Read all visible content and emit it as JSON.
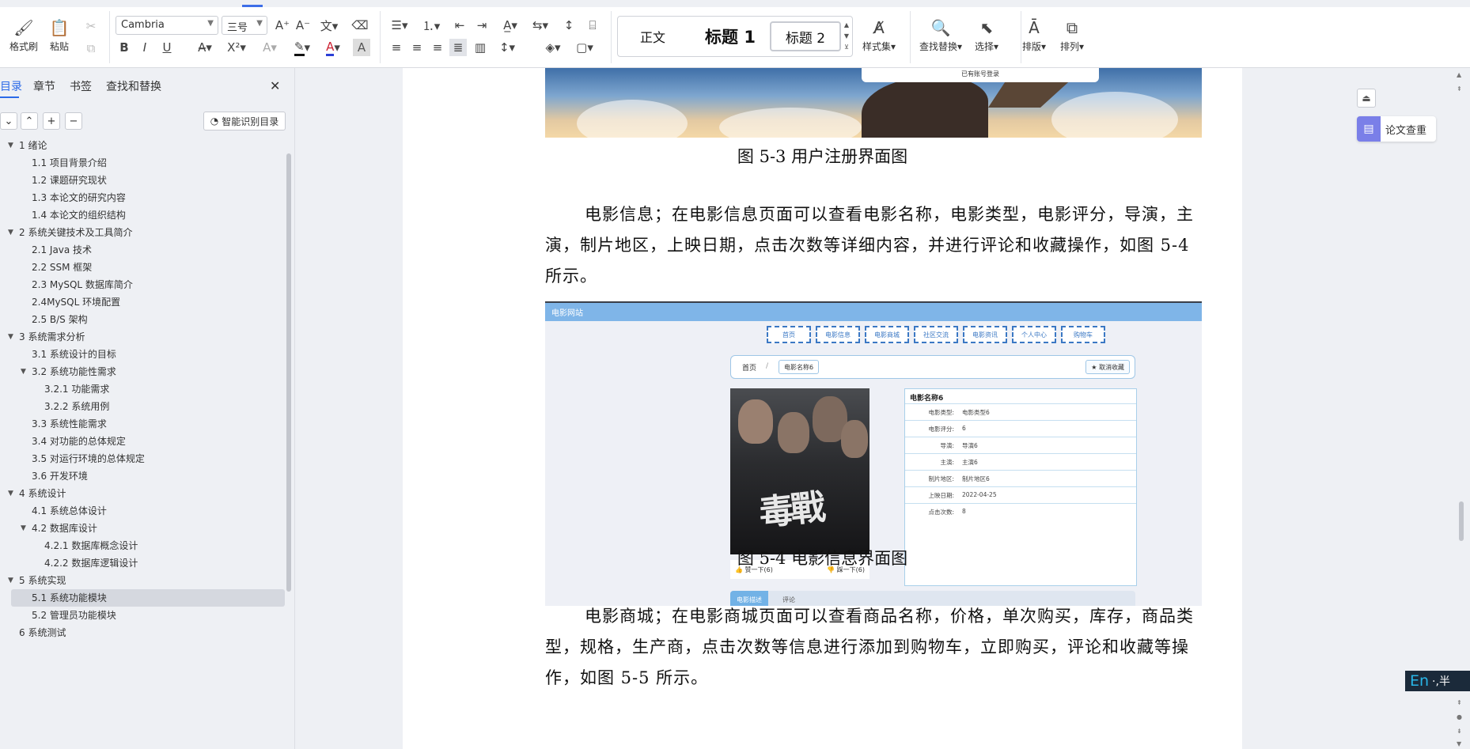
{
  "ribbon": {
    "format_painter": "格式刷",
    "paste": "粘贴",
    "font_name": "Cambria",
    "font_size": "三号",
    "style_gallery": [
      "正文",
      "标题 1",
      "标题 2"
    ],
    "style_set": "样式集",
    "find_replace": "查找替换",
    "select": "选择",
    "layout": "排版",
    "arrange": "排列",
    "bold": "B",
    "italic": "I",
    "underline": "U"
  },
  "nav": {
    "tabs": [
      "目录",
      "章节",
      "书签",
      "查找和替换"
    ],
    "smart_button": "智能识别目录",
    "toc": [
      {
        "label": "1 绪论",
        "level": 0,
        "expanded": true
      },
      {
        "label": "1.1 项目背景介绍",
        "level": 1
      },
      {
        "label": "1.2 课题研究现状",
        "level": 1
      },
      {
        "label": "1.3 本论文的研究内容",
        "level": 1
      },
      {
        "label": "1.4 本论文的组织结构",
        "level": 1
      },
      {
        "label": "2 系统关键技术及工具简介",
        "level": 0,
        "expanded": true
      },
      {
        "label": "2.1 Java 技术",
        "level": 1
      },
      {
        "label": "2.2 SSM 框架",
        "level": 1
      },
      {
        "label": "2.3 MySQL 数据库简介",
        "level": 1
      },
      {
        "label": "2.4MySQL 环境配置",
        "level": 1
      },
      {
        "label": "2.5 B/S 架构",
        "level": 1
      },
      {
        "label": "3 系统需求分析",
        "level": 0,
        "expanded": true
      },
      {
        "label": "3.1 系统设计的目标",
        "level": 1
      },
      {
        "label": "3.2 系统功能性需求",
        "level": 1,
        "expanded": true
      },
      {
        "label": "3.2.1  功能需求",
        "level": 2
      },
      {
        "label": "3.2.2  系统用例",
        "level": 2
      },
      {
        "label": "3.3 系统性能需求",
        "level": 1
      },
      {
        "label": "3.4 对功能的总体规定",
        "level": 1
      },
      {
        "label": "3.5 对运行环境的总体规定",
        "level": 1
      },
      {
        "label": "3.6 开发环境",
        "level": 1
      },
      {
        "label": "4 系统设计",
        "level": 0,
        "expanded": true
      },
      {
        "label": "4.1 系统总体设计",
        "level": 1
      },
      {
        "label": "4.2 数据库设计",
        "level": 1,
        "expanded": true
      },
      {
        "label": "4.2.1  数据库概念设计",
        "level": 2
      },
      {
        "label": "4.2.2  数据库逻辑设计",
        "level": 2
      },
      {
        "label": "5 系统实现",
        "level": 0,
        "expanded": true
      },
      {
        "label": "5.1  系统功能模块",
        "level": 1,
        "active": true
      },
      {
        "label": "5.2  管理员功能模块",
        "level": 1
      },
      {
        "label": "6 系统测试",
        "level": 0
      }
    ]
  },
  "doc": {
    "fig3_popup": "已有账号登录",
    "caption_3": "图 5-3 用户注册界面图",
    "para_1": "电影信息；在电影信息页面可以查看电影名称，电影类型，电影评分，导演，主演，制片地区，上映日期，点击次数等详细内容，并进行评论和收藏操作，如图 5-4 所示。",
    "caption_4": "图 5-4 电影信息界面图",
    "para_2": "电影商城；在电影商城页面可以查看商品名称，价格，单次购买，库存，商品类型，规格，生产商，点击次数等信息进行添加到购物车，立即购买，评论和收藏等操作，如图 5-5 所示。",
    "fig4": {
      "site_title": "电影网站",
      "menu": [
        "首页",
        "电影信息",
        "电影商城",
        "社区交流",
        "电影资讯",
        "个人中心",
        "购物车"
      ],
      "breadcrumb_home": "首页",
      "breadcrumb_sep": "/",
      "breadcrumb_current": "电影名称6",
      "unfavorite": "★ 取消收藏",
      "poster_title": "毒戰",
      "like": "赞一下(6)",
      "dislike": "踩一下(6)",
      "info_title": "电影名称6",
      "info": [
        {
          "k": "电影类型:",
          "v": "电影类型6"
        },
        {
          "k": "电影评分:",
          "v": "6"
        },
        {
          "k": "导演:",
          "v": "导演6"
        },
        {
          "k": "主演:",
          "v": "主演6"
        },
        {
          "k": "制片地区:",
          "v": "制片地区6"
        },
        {
          "k": "上映日期:",
          "v": "2022-04-25"
        },
        {
          "k": "点击次数:",
          "v": "8"
        }
      ],
      "tab_detail": "电影描述",
      "tab_comment": "评论"
    }
  },
  "right": {
    "plagiarism_check": "论文查重",
    "ime_lang": "En",
    "ime_mode": "·,半"
  }
}
